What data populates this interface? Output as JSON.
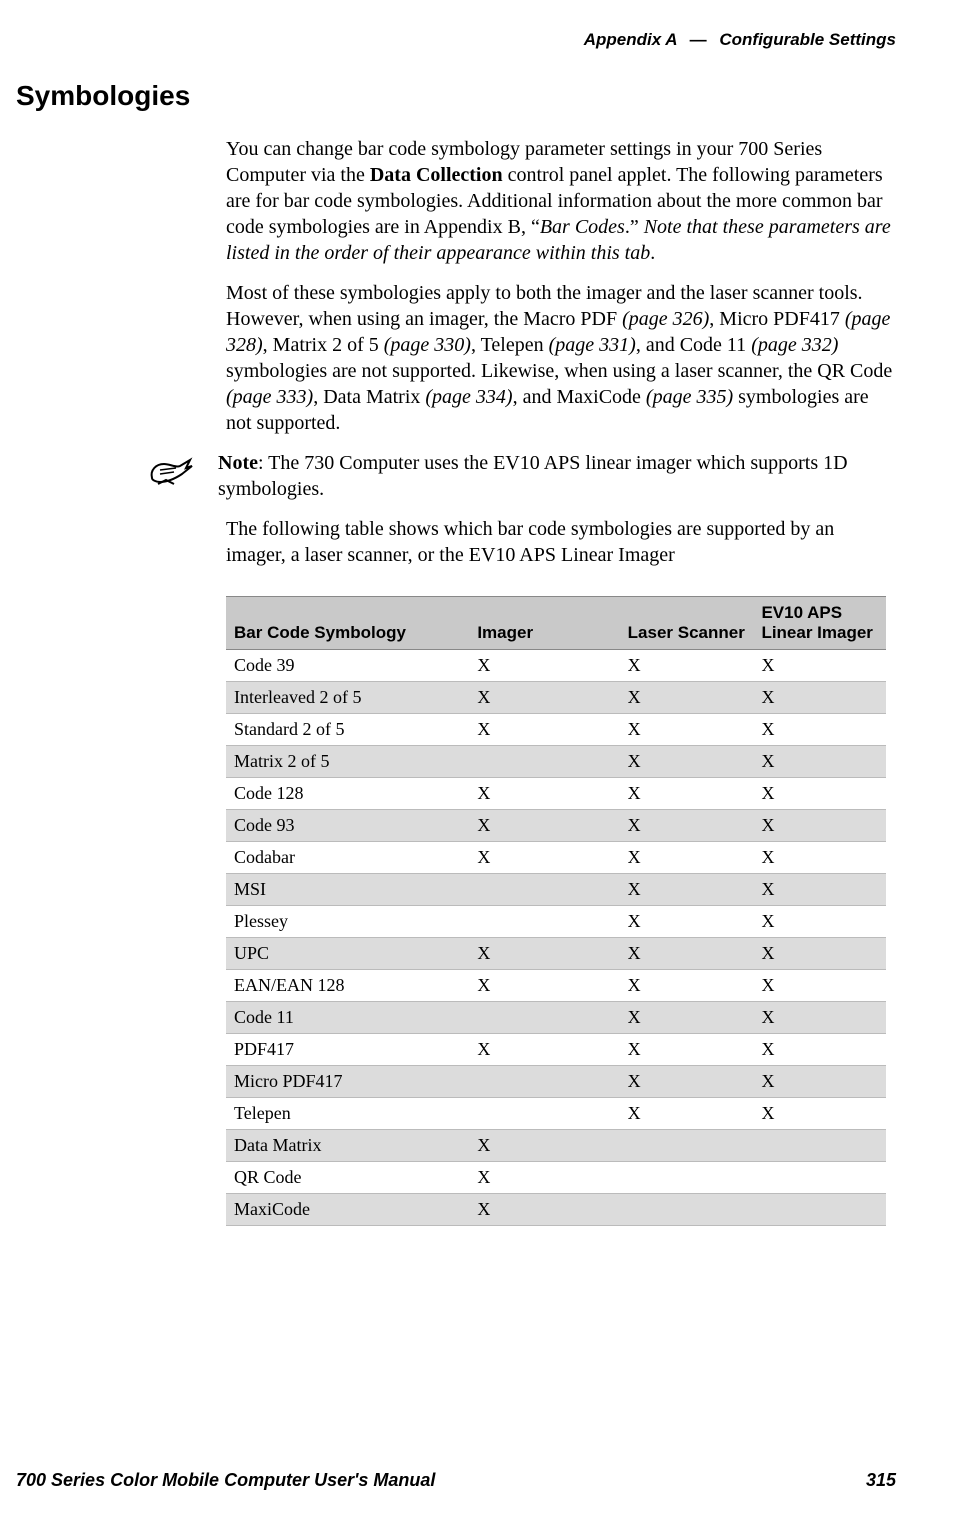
{
  "header": {
    "appendix": "Appendix A",
    "dash": "—",
    "title": "Configurable Settings"
  },
  "section_title": "Symbologies",
  "para1": {
    "t1": "You can change bar code symbology parameter settings in your 700 Series Computer via the ",
    "bold": "Data Collection",
    "t2": " control panel applet. The following parameters are for bar code symbologies. Additional information about the more common bar code symbologies are in Appendix B, “",
    "i1": "Bar Codes",
    "t3": ".” ",
    "i2": "Note that these parameters are listed in the order of their appearance within this tab",
    "t4": "."
  },
  "para2": {
    "t1": "Most of these symbologies apply to both the imager and the laser scanner tools. However, when using an imager, the Macro PDF ",
    "i1": "(page 326)",
    "t2": ", Micro PDF417 ",
    "i2": "(page 328)",
    "t3": ", Matrix 2 of 5 ",
    "i3": "(page 330)",
    "t4": ", Telepen ",
    "i4": "(page 331)",
    "t5": ", and Code 11 ",
    "i5": "(page 332)",
    "t6": " symbologies are not supported. Likewise, when using a laser scanner, the QR Code ",
    "i6": "(page 333)",
    "t7": ", Data Matrix ",
    "i7": "(page 334)",
    "t8": ", and MaxiCode ",
    "i8": "(page 335)",
    "t9": " symbologies are not supported."
  },
  "note": {
    "label": "Note",
    "text": ": The 730 Computer uses the EV10 APS linear imager which supports 1D symbologies."
  },
  "para3": "The following table shows which bar code symbologies are supported by an imager, a laser scanner, or the EV10 APS Linear Imager",
  "table": {
    "headers": [
      "Bar Code Symbology",
      "Imager",
      "Laser Scanner",
      "EV10 APS Linear Imager"
    ],
    "rows": [
      {
        "cells": [
          "Code 39",
          "X",
          "X",
          "X"
        ],
        "shade": false
      },
      {
        "cells": [
          "Interleaved 2 of 5",
          "X",
          "X",
          "X"
        ],
        "shade": true
      },
      {
        "cells": [
          "Standard 2 of 5",
          "X",
          "X",
          "X"
        ],
        "shade": false
      },
      {
        "cells": [
          "Matrix 2 of 5",
          "",
          "X",
          "X"
        ],
        "shade": true
      },
      {
        "cells": [
          "Code 128",
          "X",
          "X",
          "X"
        ],
        "shade": false
      },
      {
        "cells": [
          "Code 93",
          "X",
          "X",
          "X"
        ],
        "shade": true
      },
      {
        "cells": [
          "Codabar",
          "X",
          "X",
          "X"
        ],
        "shade": false
      },
      {
        "cells": [
          "MSI",
          "",
          "X",
          "X"
        ],
        "shade": true
      },
      {
        "cells": [
          "Plessey",
          "",
          "X",
          "X"
        ],
        "shade": false
      },
      {
        "cells": [
          "UPC",
          "X",
          "X",
          "X"
        ],
        "shade": true
      },
      {
        "cells": [
          "EAN/EAN 128",
          "X",
          "X",
          "X"
        ],
        "shade": false
      },
      {
        "cells": [
          "Code 11",
          "",
          "X",
          "X"
        ],
        "shade": true
      },
      {
        "cells": [
          "PDF417",
          "X",
          "X",
          "X"
        ],
        "shade": false
      },
      {
        "cells": [
          "Micro PDF417",
          "",
          "X",
          "X"
        ],
        "shade": true
      },
      {
        "cells": [
          "Telepen",
          "",
          "X",
          "X"
        ],
        "shade": false
      },
      {
        "cells": [
          "Data Matrix",
          "X",
          "",
          ""
        ],
        "shade": true
      },
      {
        "cells": [
          "QR Code",
          "X",
          "",
          ""
        ],
        "shade": false
      },
      {
        "cells": [
          "MaxiCode",
          "X",
          "",
          ""
        ],
        "shade": true
      }
    ]
  },
  "footer": {
    "title": "700 Series Color Mobile Computer User's Manual",
    "page": "315"
  }
}
